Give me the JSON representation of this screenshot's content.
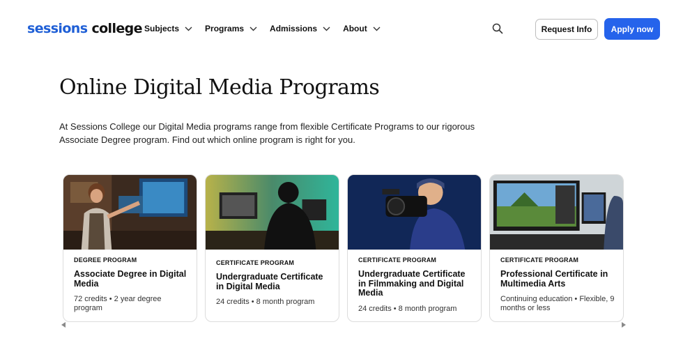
{
  "header": {
    "logo_part1": "sessions",
    "logo_part2": "college",
    "nav": [
      {
        "label": "Subjects"
      },
      {
        "label": "Programs"
      },
      {
        "label": "Admissions"
      },
      {
        "label": "About"
      }
    ],
    "request_info_label": "Request Info",
    "apply_label": "Apply now"
  },
  "hero": {
    "title": "Online Digital Media Programs",
    "intro": "At Sessions College our Digital Media programs range from flexible Certificate Programs to our rigorous Associate Degree program. Find out which online program is right for you."
  },
  "cards": [
    {
      "type": "DEGREE PROGRAM",
      "title": "Associate Degree in Digital Media",
      "meta": "72 credits • 2 year degree program"
    },
    {
      "type": "CERTIFICATE PROGRAM",
      "title": "Undergraduate Certificate in Digital Media",
      "meta": "24 credits • 8 month program"
    },
    {
      "type": "CERTIFICATE PROGRAM",
      "title": "Undergraduate Certificate in Filmmaking and Digital Media",
      "meta": "24 credits • 8 month program"
    },
    {
      "type": "CERTIFICATE PROGRAM",
      "title": "Professional Certificate in Multimedia Arts",
      "meta": "Continuing education • Flexible, 9 months or less"
    }
  ],
  "colors": {
    "brand_blue": "#1f5fd6",
    "apply_button": "#2563eb"
  },
  "icons": {
    "search": "search-icon",
    "chevron": "chevron-down-icon",
    "carousel_prev": "carousel-prev-icon",
    "carousel_next": "carousel-next-icon"
  }
}
